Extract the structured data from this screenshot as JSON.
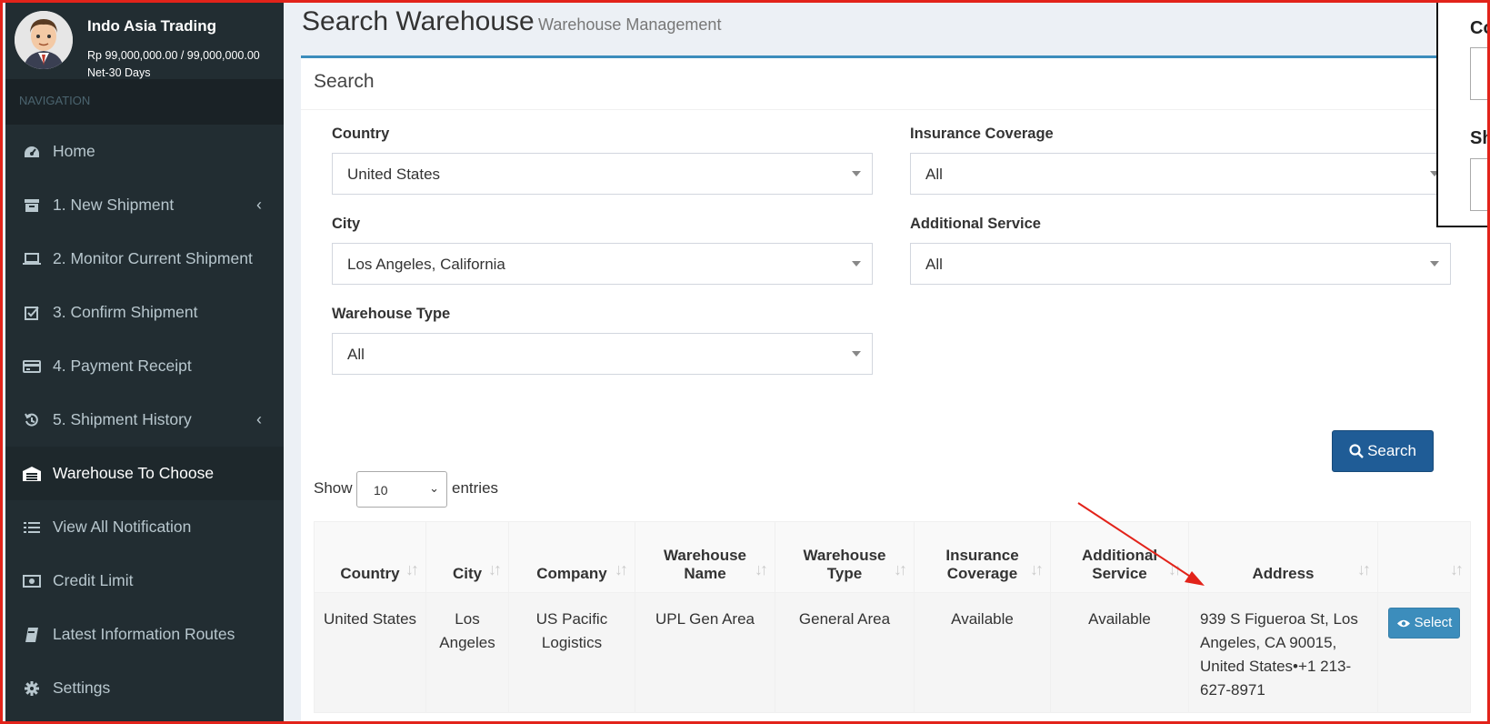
{
  "user": {
    "name": "Indo Asia Trading",
    "credit": "Rp 99,000,000.00 / 99,000,000.00",
    "term": "Net-30 Days"
  },
  "nav": {
    "header": "NAVIGATION",
    "items": [
      {
        "label": "Home",
        "icon": "dashboard-icon"
      },
      {
        "label": "1. New Shipment",
        "icon": "archive-icon"
      },
      {
        "label": "2. Monitor Current Shipment",
        "icon": "laptop-icon"
      },
      {
        "label": "3. Confirm Shipment",
        "icon": "check-square-icon"
      },
      {
        "label": "4. Payment Receipt",
        "icon": "credit-card-icon"
      },
      {
        "label": "5. Shipment History",
        "icon": "history-icon"
      },
      {
        "label": "Warehouse To Choose",
        "icon": "warehouse-icon"
      },
      {
        "label": "View All Notification",
        "icon": "list-icon"
      },
      {
        "label": "Credit Limit",
        "icon": "money-icon"
      },
      {
        "label": "Latest Information Routes",
        "icon": "book-icon"
      },
      {
        "label": "Settings",
        "icon": "gear-icon"
      }
    ]
  },
  "page": {
    "title": "Search Warehouse",
    "subtitle": "Warehouse Management"
  },
  "search": {
    "box_title": "Search",
    "country_label": "Country",
    "country_value": "United States",
    "city_label": "City",
    "city_value": "Los Angeles, California",
    "type_label": "Warehouse Type",
    "type_value": "All",
    "insurance_label": "Insurance Coverage",
    "insurance_value": "All",
    "service_label": "Additional Service",
    "service_value": "All",
    "button": "Search"
  },
  "table_controls": {
    "show": "Show",
    "length": "10",
    "entries": "entries"
  },
  "table": {
    "headers": [
      "Country",
      "City",
      "Company",
      "Warehouse Name",
      "Warehouse Type",
      "Insurance Coverage",
      "Additional Service",
      "Address",
      ""
    ],
    "header_lines": [
      [
        "Country"
      ],
      [
        "City"
      ],
      [
        "Company"
      ],
      [
        "Warehouse",
        "Name"
      ],
      [
        "Warehouse",
        "Type"
      ],
      [
        "Insurance",
        "Coverage"
      ],
      [
        "Additional",
        "Service"
      ],
      [
        "Address"
      ],
      [
        ""
      ]
    ],
    "rows": [
      {
        "country": "United States",
        "city": "Los Angeles",
        "company": "US Pacific Logistics",
        "warehouse_name": "UPL Gen Area",
        "warehouse_type": "General Area",
        "insurance": "Available",
        "service": "Available",
        "address": "939 S Figueroa St, Los Angeles, CA 90015, United States•+1 213-627-8971",
        "action": "Select"
      }
    ]
  },
  "overlay": {
    "label1": "Co",
    "label2": "Sh"
  },
  "colors": {
    "sidebar_bg": "#222d32",
    "accent": "#3c8dbc",
    "search_button": "#1f5c96",
    "frame": "#e2231a",
    "arrow": "#e2231a"
  }
}
